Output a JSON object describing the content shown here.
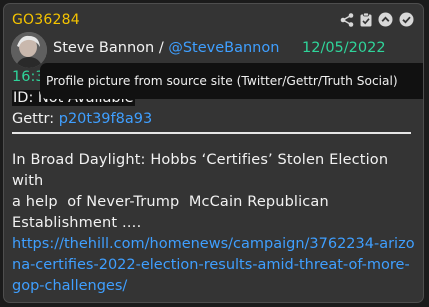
{
  "post": {
    "id": "GO36284",
    "author_name": "Steve Bannon",
    "separator": "/",
    "handle": "@SteveBannon",
    "date": "12/05/2022",
    "time_partial": "16:3",
    "tooltip": "Profile picture from source site (Twitter/Gettr/Truth Social)",
    "id_line": "ID: Not Available",
    "gettr_label": "Gettr:",
    "gettr_value": "p20t39f8a93",
    "body": "In Broad Daylight: Hobbs ‘Certifies’ Stolen Election with\na help  of Never-Trump  McCain Republican\nEstablishment ….",
    "link": "https://thehill.com/homenews/campaign/3762234-arizona-certifies-2022-election-results-amid-threat-of-more-gop-challenges/"
  },
  "icons": [
    "share-icon",
    "clipboard-check-icon",
    "chevron-up-circle-icon",
    "check-circle-icon"
  ],
  "colors": {
    "post_id": "#f5c400",
    "date": "#2fd49a",
    "link": "#3f9fff",
    "card_bg": "#343434"
  }
}
